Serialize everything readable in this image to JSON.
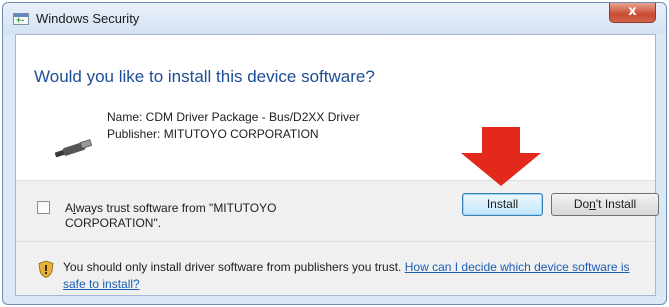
{
  "window": {
    "title": "Windows Security",
    "close_glyph": "x"
  },
  "prompt": {
    "question": "Would you like to install this device software?",
    "name_line": "Name: CDM Driver Package - Bus/D2XX Driver",
    "publisher_line": "Publisher: MITUTOYO CORPORATION",
    "device_icon": "usb-plug-icon"
  },
  "trust": {
    "label_prefix": "A",
    "label_mnemonic": "l",
    "label_rest": "ways trust software from \"MITUTOYO CORPORATION\".",
    "checked": false
  },
  "buttons": {
    "install_label": "Install",
    "dont_install_prefix": "Do",
    "dont_install_mnemonic": "n",
    "dont_install_rest": "'t Install"
  },
  "annotation": {
    "arrow_color": "#e3281c",
    "arrow_icon": "red-down-arrow-icon"
  },
  "footer": {
    "warning_text": "You should only install driver software from publishers you trust.",
    "help_link": "How can I decide which device software is safe to install?",
    "shield_icon": "shield-warning-icon"
  },
  "colors": {
    "question": "#1c4d95",
    "link": "#1a5fb4",
    "close_button": "#c74a34"
  }
}
